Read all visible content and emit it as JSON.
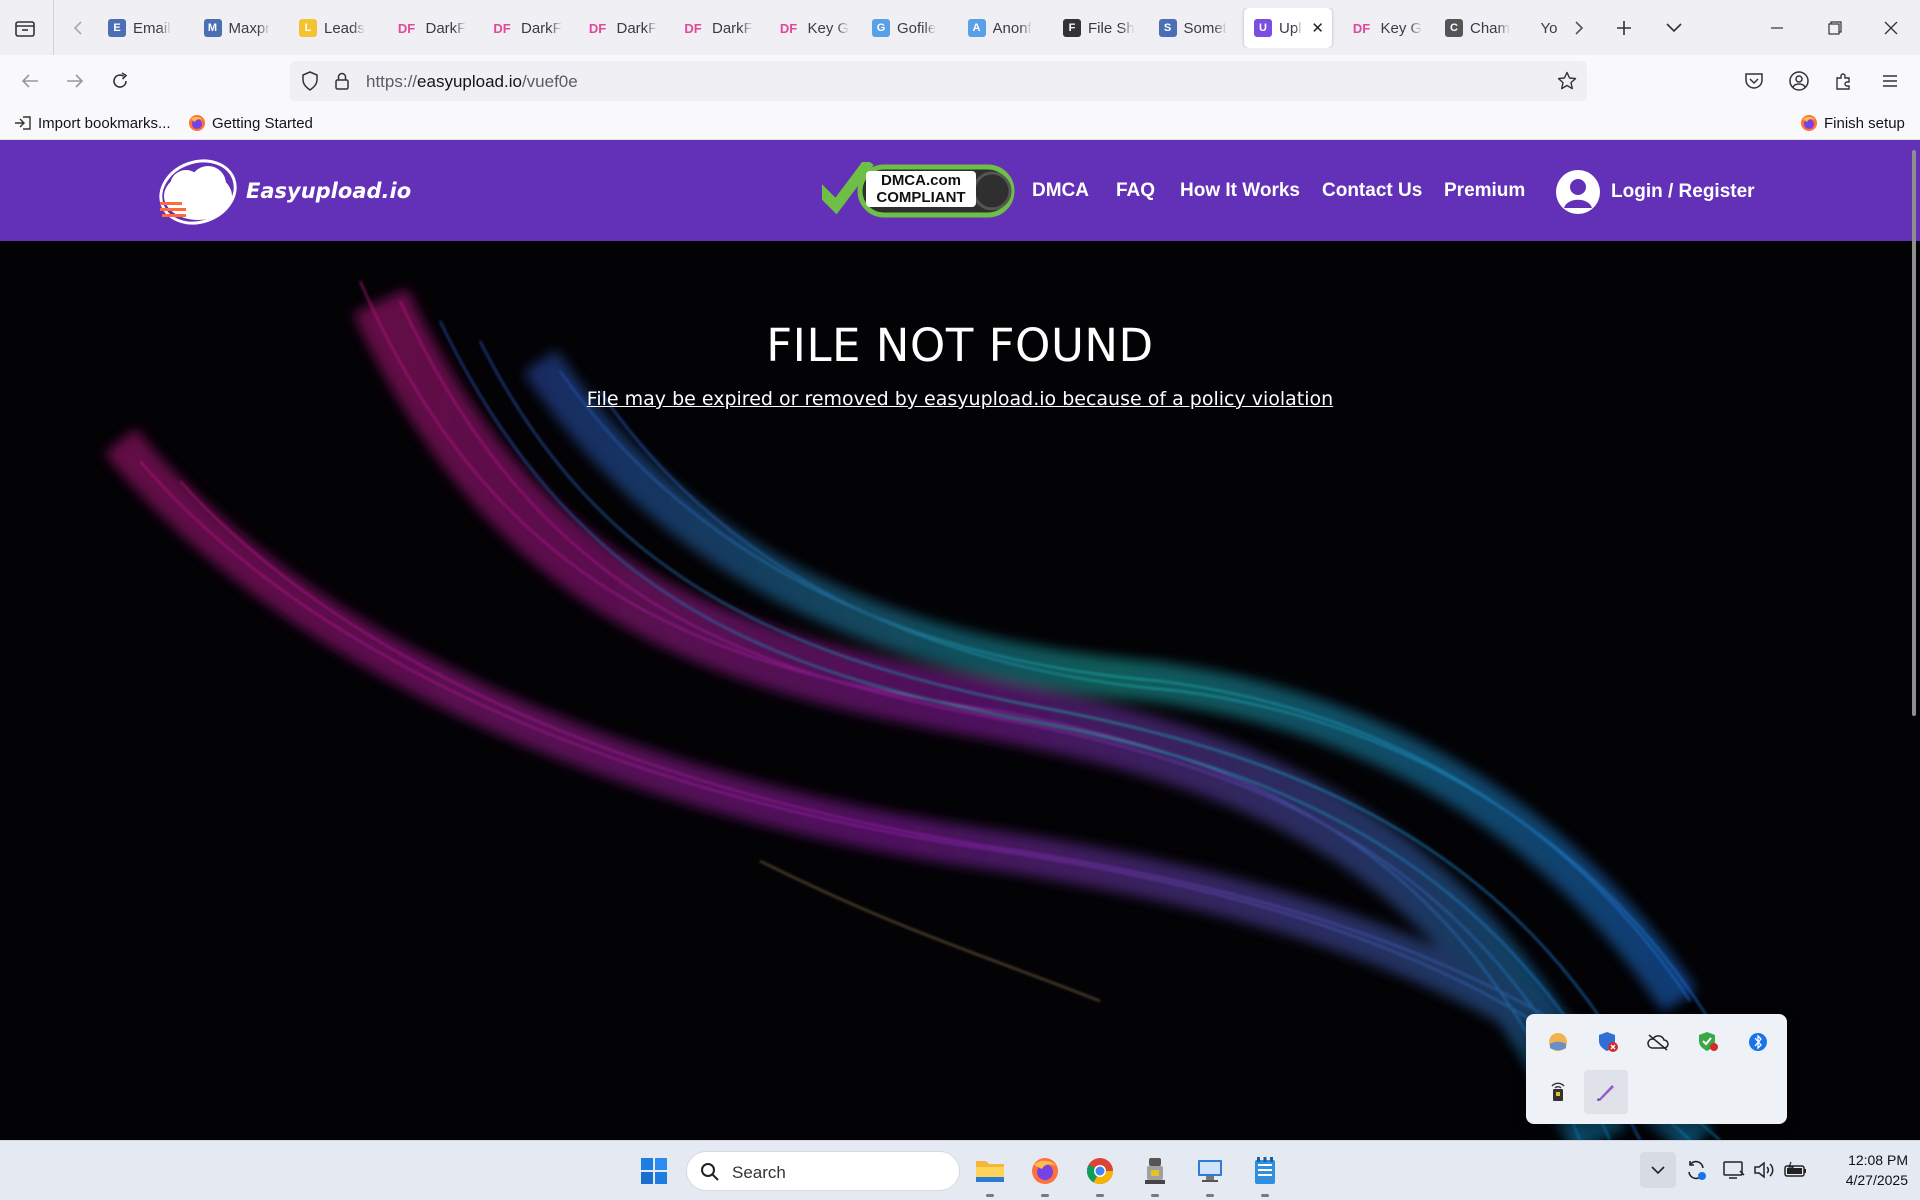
{
  "browser": {
    "tabs": [
      {
        "label": "Email",
        "fav": "E",
        "fav_bg": "#4a6fb5"
      },
      {
        "label": "Maxpr",
        "fav": "M",
        "fav_bg": "#4a6fb5"
      },
      {
        "label": "Leads",
        "fav": "L",
        "fav_bg": "#f4c430"
      },
      {
        "label": "DarkF",
        "fav": "DF",
        "fav_bg": ""
      },
      {
        "label": "DarkF",
        "fav": "DF",
        "fav_bg": ""
      },
      {
        "label": "DarkF",
        "fav": "DF",
        "fav_bg": ""
      },
      {
        "label": "DarkF",
        "fav": "DF",
        "fav_bg": ""
      },
      {
        "label": "Key G",
        "fav": "DF",
        "fav_bg": ""
      },
      {
        "label": "Gofile",
        "fav": "G",
        "fav_bg": "#5aa0e6"
      },
      {
        "label": "Anonf",
        "fav": "A",
        "fav_bg": "#5aa0e6"
      },
      {
        "label": "File Sh",
        "fav": "F",
        "fav_bg": "#333"
      },
      {
        "label": "Somet",
        "fav": "S",
        "fav_bg": "#4a6fb5"
      },
      {
        "label": "Upl",
        "fav": "U",
        "fav_bg": "#7b4de0",
        "active": true
      },
      {
        "label": "Key G",
        "fav": "DF",
        "fav_bg": ""
      },
      {
        "label": "Cham",
        "fav": "C",
        "fav_bg": "#555"
      },
      {
        "label": "You",
        "fav": "",
        "fav_bg": ""
      }
    ],
    "url_prefix": "https://",
    "url_domain": "easyupload.io",
    "url_path": "/vuef0e",
    "bookmarks": {
      "import": "Import bookmarks...",
      "getting_started": "Getting Started",
      "finish_setup": "Finish setup"
    }
  },
  "site": {
    "logo_name": "Easyupload.io",
    "dmca_line1": "DMCA.com",
    "dmca_line2": "COMPLIANT",
    "nav": {
      "dmca": "DMCA",
      "faq": "FAQ",
      "how": "How It Works",
      "contact": "Contact Us",
      "premium": "Premium"
    },
    "login": "Login / Register",
    "brand_color": "#6331b8"
  },
  "hero": {
    "title": "FILE NOT FOUND",
    "message": "File may be expired or removed by easyupload.io because of a policy violation"
  },
  "taskbar": {
    "search_placeholder": "Search",
    "time": "12:08 PM",
    "date": "4/27/2025"
  }
}
